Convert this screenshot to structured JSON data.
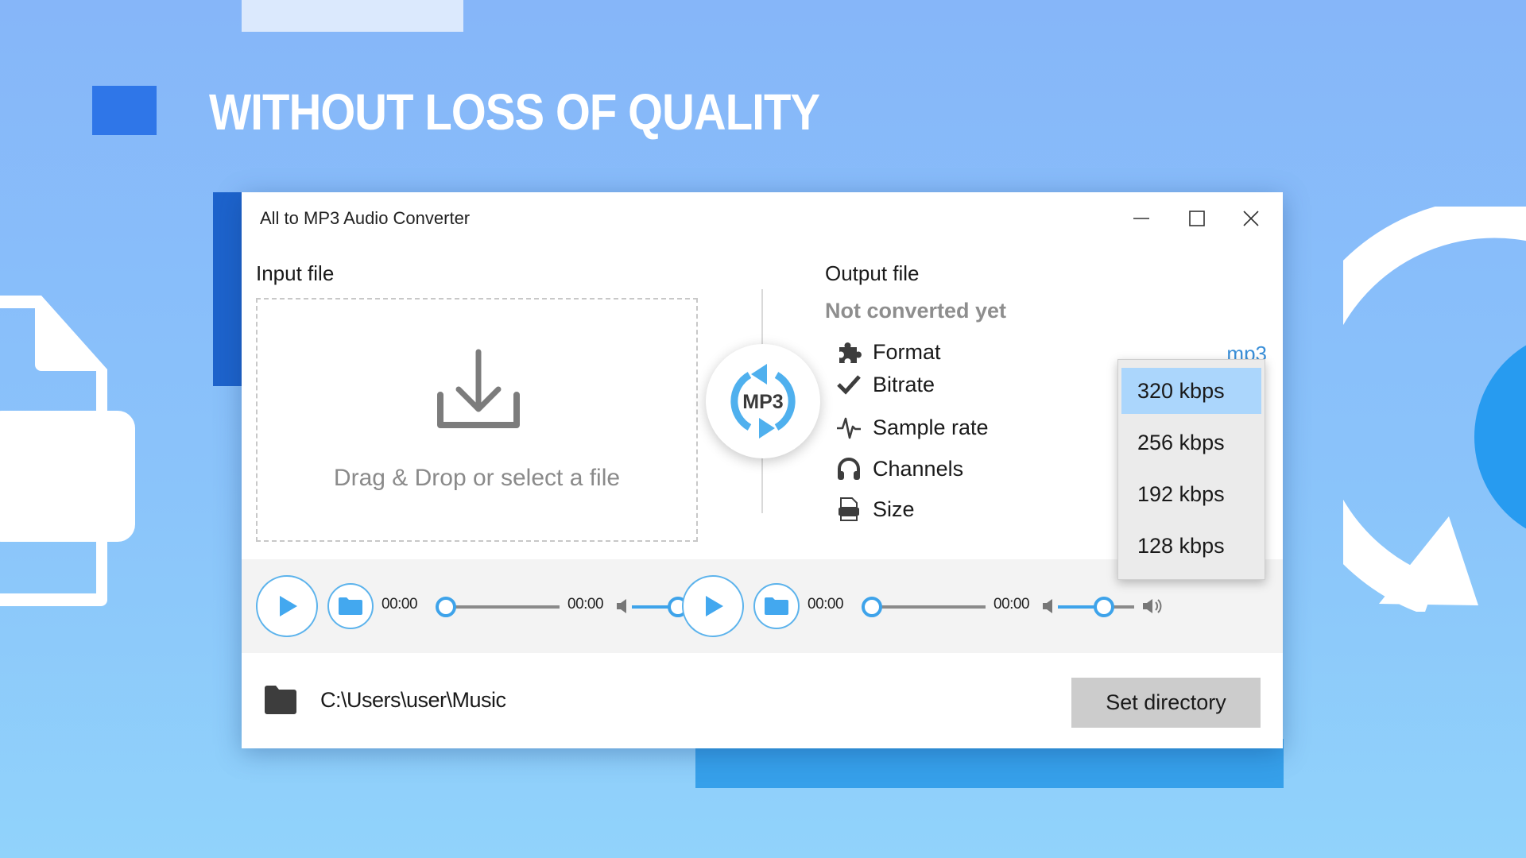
{
  "banner": {
    "headline": "WITHOUT LOSS OF QUALITY"
  },
  "window": {
    "title": "All to MP3 Audio Converter",
    "controls": {
      "minimize": "minimize-icon",
      "maximize": "maximize-icon",
      "close": "close-icon"
    }
  },
  "input": {
    "label": "Input file",
    "drop_text": "Drag & Drop or select a file",
    "drop_icon": "download-icon"
  },
  "convert_button": {
    "label": "MP3",
    "icon": "refresh-arrows-icon",
    "color": "#4fb0ee"
  },
  "output": {
    "label": "Output file",
    "status": "Not converted yet",
    "format_value": "mp3",
    "properties": [
      {
        "icon": "puzzle-icon",
        "label": "Format"
      },
      {
        "icon": "checkmark-icon",
        "label": "Bitrate"
      },
      {
        "icon": "pulse-icon",
        "label": "Sample rate"
      },
      {
        "icon": "headphones-icon",
        "label": "Channels"
      },
      {
        "icon": "drive-icon",
        "label": "Size"
      }
    ]
  },
  "bitrate_dropdown": {
    "selected": "320  kbps",
    "options": [
      "320  kbps",
      "256  kbps",
      "192  kbps",
      "128  kbps"
    ],
    "highlight_color": "#abd6fc"
  },
  "players": {
    "input": {
      "current_time": "00:00",
      "total_time": "00:00",
      "progress": 0,
      "volume": 0.6
    },
    "output": {
      "current_time": "00:00",
      "total_time": "00:00",
      "progress": 0,
      "volume": 0.6
    },
    "accent_color": "#3ea3ea"
  },
  "footer": {
    "directory_path": "C:\\Users\\user\\Music",
    "set_directory_label": "Set directory"
  }
}
